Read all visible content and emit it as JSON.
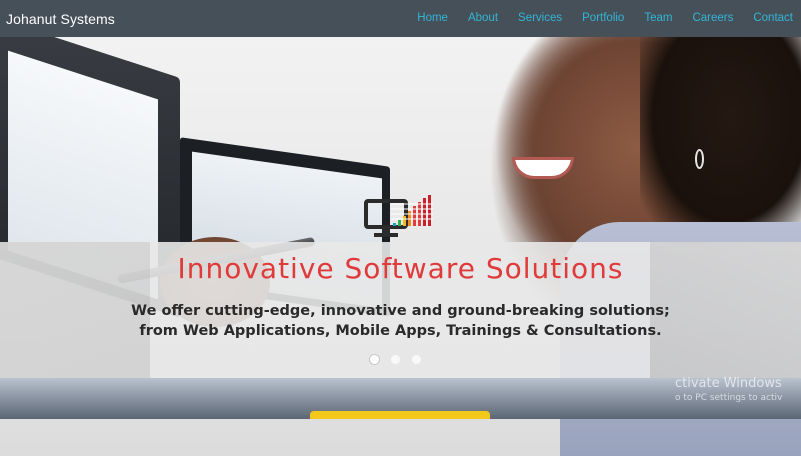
{
  "header": {
    "brand": "Johanut Systems",
    "nav": [
      {
        "label": "Home"
      },
      {
        "label": "About"
      },
      {
        "label": "Services"
      },
      {
        "label": "Portfolio"
      },
      {
        "label": "Team"
      },
      {
        "label": "Careers"
      },
      {
        "label": "Contact"
      }
    ]
  },
  "hero": {
    "title": "Innovative Software Solutions",
    "subtitle_line1": "We offer cutting-edge, innovative and ground-breaking solutions;",
    "subtitle_line2": "from Web Applications, Mobile Apps, Trainings & Consultations.",
    "logo_icon": "monitor-chart-icon",
    "carousel_slide_count": 3,
    "active_slide": 1
  },
  "watermark": {
    "line1": "ctivate Windows",
    "line2": "o to PC settings to activ"
  },
  "colors": {
    "navbar_bg": "#465058",
    "nav_link": "#33b5d6",
    "title": "#e03a3a",
    "subtitle": "#2a2a2a",
    "button": "#f2c91a"
  }
}
